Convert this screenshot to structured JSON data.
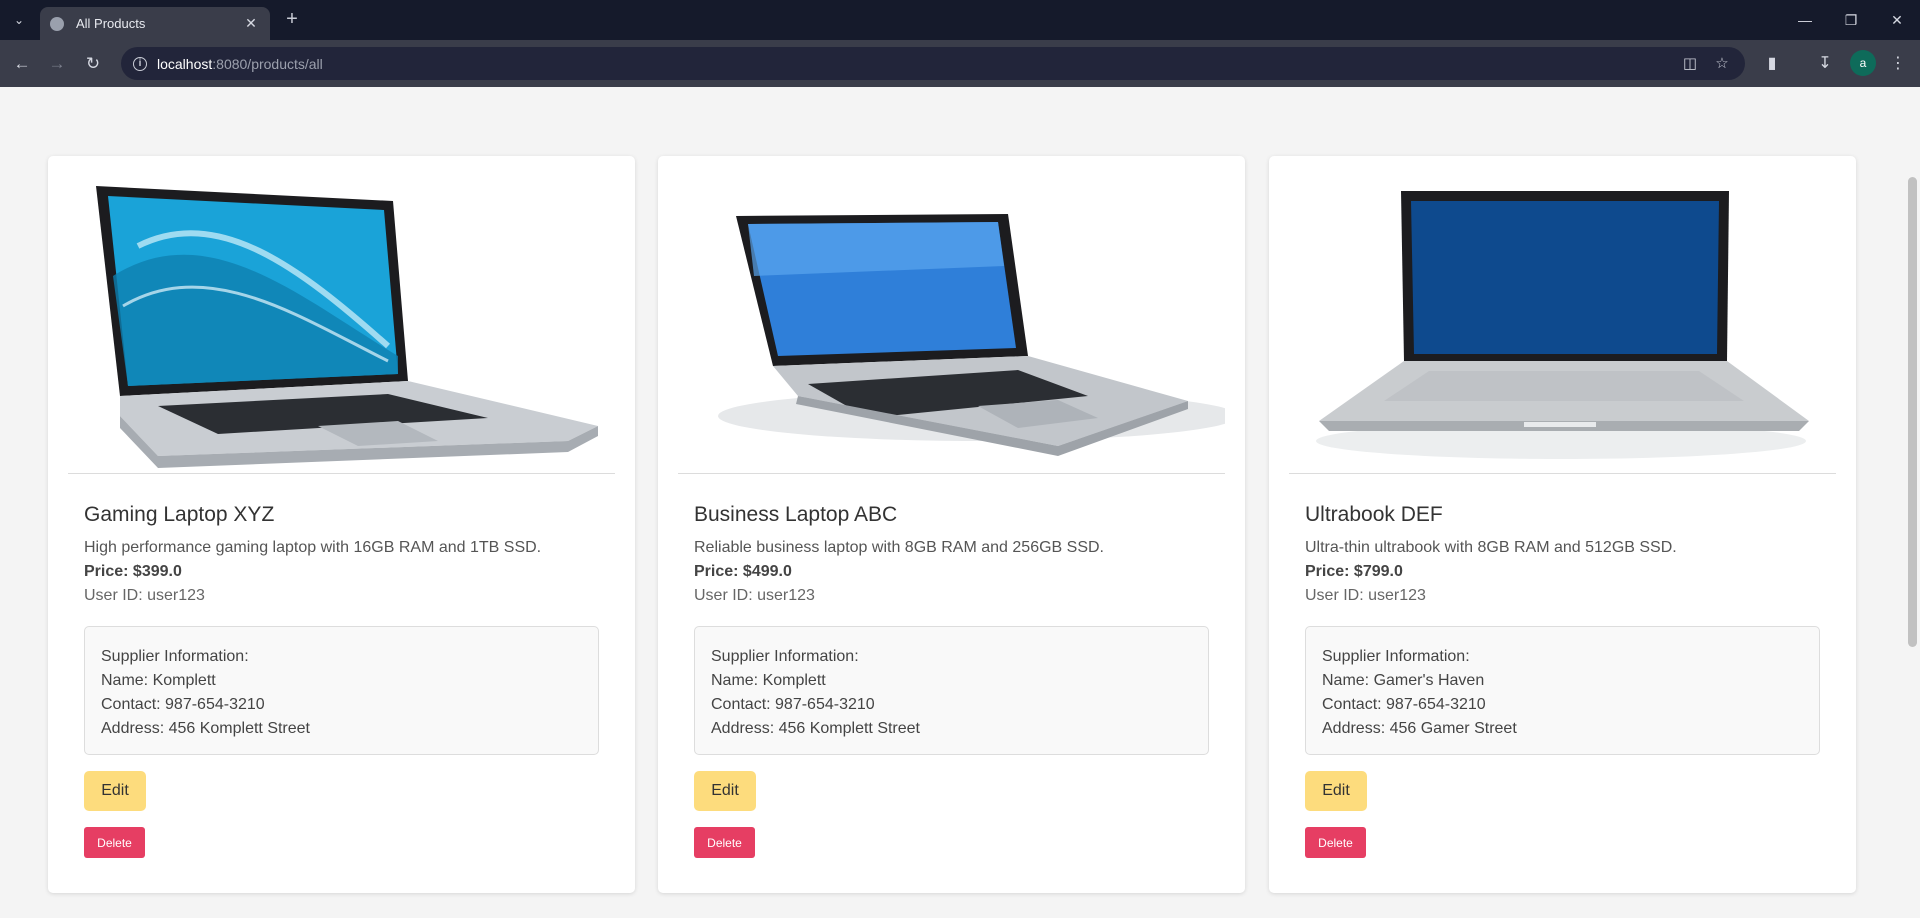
{
  "browser": {
    "tab_title": "All Products",
    "url_host": "localhost",
    "url_path": ":8080/products/all",
    "avatar_letter": "a"
  },
  "products": [
    {
      "name": "Gaming Laptop XYZ",
      "description": "High performance gaming laptop with 16GB RAM and 1TB SSD.",
      "price": "Price: $399.0",
      "user_id": "User ID: user123",
      "supplier": {
        "heading": "Supplier Information:",
        "name": "Name: Komplett",
        "contact": "Contact: 987-654-3210",
        "address": "Address: 456 Komplett Street"
      },
      "edit_label": "Edit",
      "delete_label": "Delete"
    },
    {
      "name": "Business Laptop ABC",
      "description": "Reliable business laptop with 8GB RAM and 256GB SSD.",
      "price": "Price: $499.0",
      "user_id": "User ID: user123",
      "supplier": {
        "heading": "Supplier Information:",
        "name": "Name: Komplett",
        "contact": "Contact: 987-654-3210",
        "address": "Address: 456 Komplett Street"
      },
      "edit_label": "Edit",
      "delete_label": "Delete"
    },
    {
      "name": "Ultrabook DEF",
      "description": "Ultra-thin ultrabook with 8GB RAM and 512GB SSD.",
      "price": "Price: $799.0",
      "user_id": "User ID: user123",
      "supplier": {
        "heading": "Supplier Information:",
        "name": "Name: Gamer's Haven",
        "contact": "Contact: 987-654-3210",
        "address": "Address: 456 Gamer Street"
      },
      "edit_label": "Edit",
      "delete_label": "Delete"
    }
  ],
  "colors": {
    "edit_button": "#fddc7d",
    "delete_button": "#e63e63",
    "browser_frame": "#151a2b"
  }
}
